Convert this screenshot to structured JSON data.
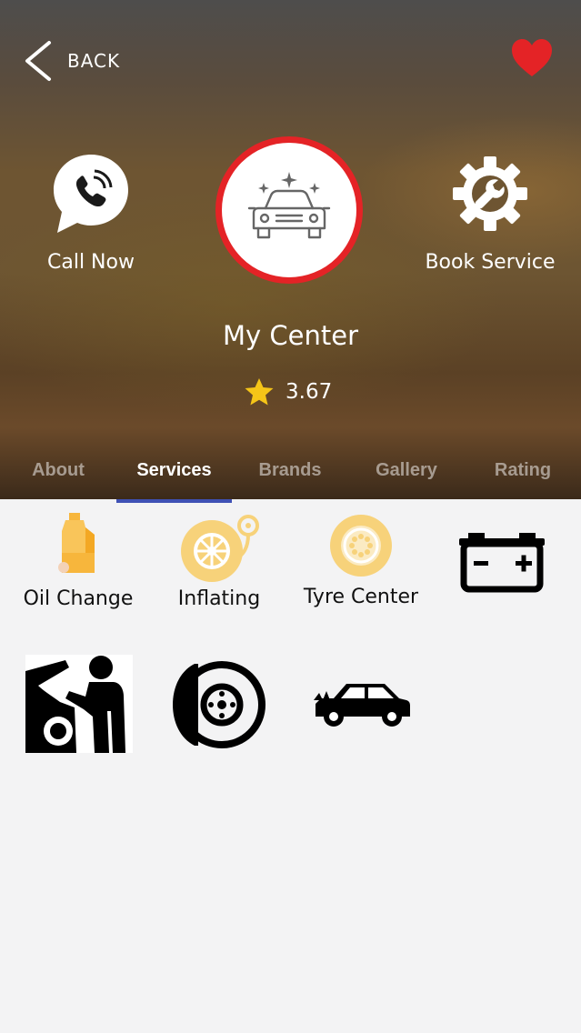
{
  "header": {
    "back_label": "BACK"
  },
  "actions": {
    "call_label": "Call Now",
    "book_label": "Book Service"
  },
  "center": {
    "name": "My Center",
    "rating": "3.67"
  },
  "tabs": [
    {
      "label": "About"
    },
    {
      "label": "Services"
    },
    {
      "label": "Brands"
    },
    {
      "label": "Gallery"
    },
    {
      "label": "Rating"
    }
  ],
  "active_tab": "Services",
  "services": [
    {
      "label": "Oil Change",
      "icon": "oil-bottle-icon"
    },
    {
      "label": "Inflating",
      "icon": "tyre-inflator-icon"
    },
    {
      "label": "Tyre Center",
      "icon": "tyre-icon"
    },
    {
      "label": "",
      "icon": "battery-icon"
    },
    {
      "label": "",
      "icon": "mechanic-icon"
    },
    {
      "label": "",
      "icon": "brake-disc-icon"
    },
    {
      "label": "",
      "icon": "car-engine-icon"
    }
  ],
  "colors": {
    "accent_red": "#e42326",
    "tab_indicator": "#3f51b5",
    "service_yellow": "#f7d27a",
    "star": "#f5c518"
  }
}
